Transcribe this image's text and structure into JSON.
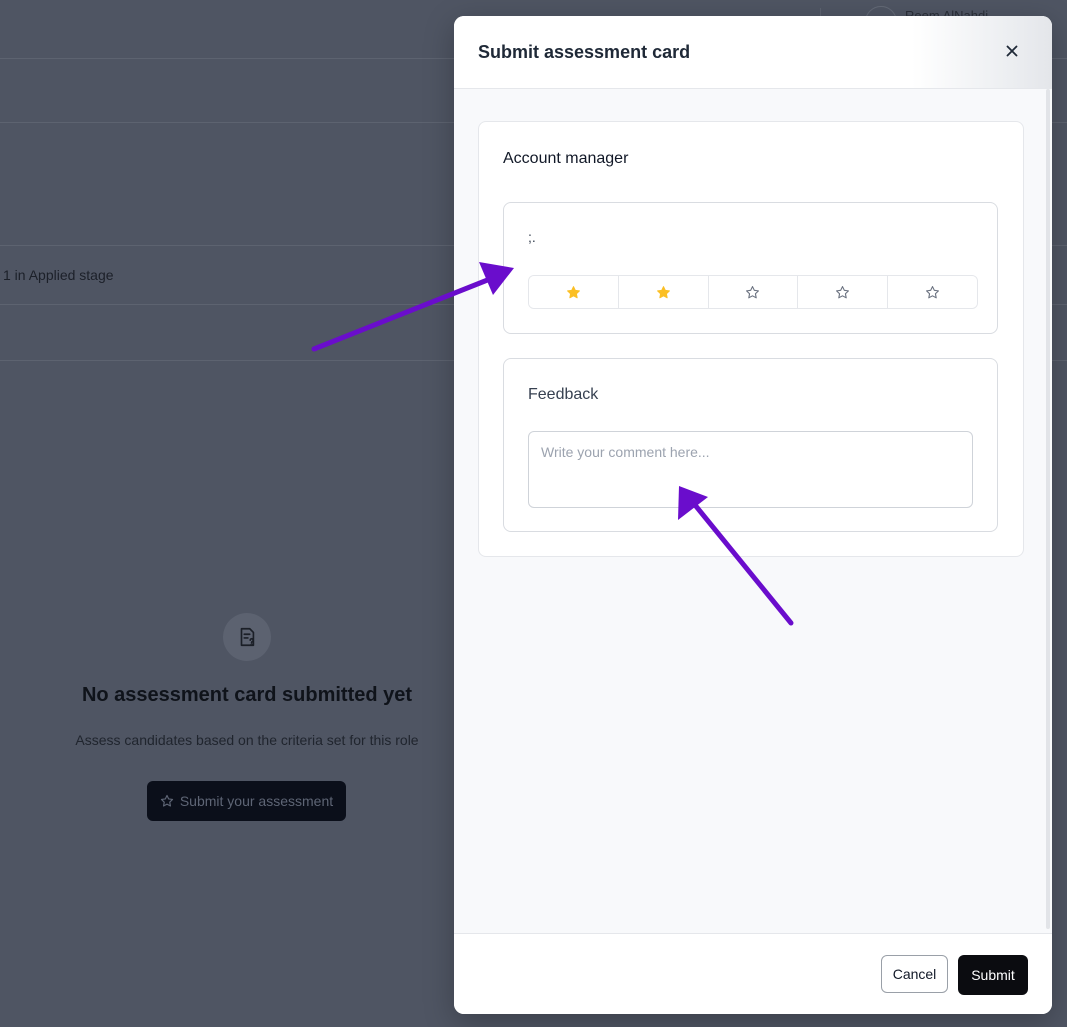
{
  "background": {
    "user_name": "Reem AlNahdi",
    "stage_text": "1 in Applied stage",
    "empty_state": {
      "icon": "file-question-icon",
      "title": "No assessment card submitted yet",
      "subtitle": "Assess candidates based on the criteria set for this role",
      "cta_icon": "star-outline-icon",
      "cta_label": "Submit your assessment"
    }
  },
  "modal": {
    "title": "Submit assessment card",
    "close_icon": "close-icon",
    "card": {
      "title": "Account manager",
      "criterion": {
        "label": ";.",
        "rating": 2,
        "max_rating": 5,
        "filled_color": "#fbbf24",
        "empty_color": "#6b7280"
      },
      "feedback": {
        "label": "Feedback",
        "placeholder": "Write your comment here...",
        "value": ""
      }
    },
    "footer": {
      "cancel_label": "Cancel",
      "submit_label": "Submit"
    }
  },
  "annotations": {
    "arrow_color": "#6a0dcc"
  }
}
